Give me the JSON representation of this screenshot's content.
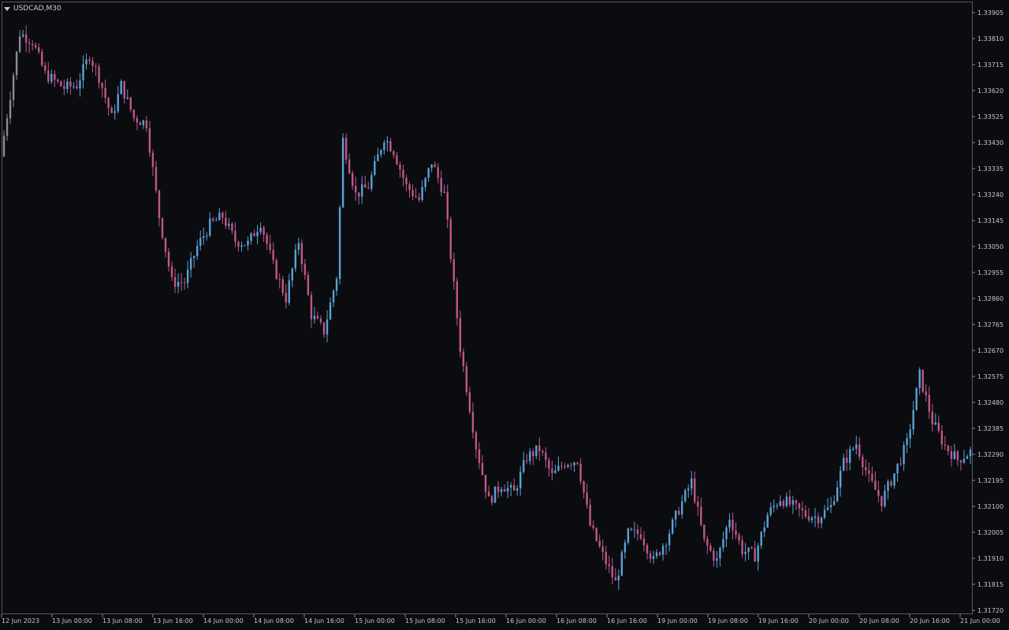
{
  "header": {
    "symbol": "USDCAD,M30"
  },
  "colors": {
    "background": "#0b0c10",
    "bull": "#5aa2d6",
    "bear": "#c0578a",
    "neutral": "#8c8c8c",
    "axis_text": "#c8c8c8",
    "frame": "#5a5a5a"
  },
  "chart_data": {
    "type": "candlestick",
    "title": "USDCAD,M30",
    "grid": false,
    "ylim": [
      1.3172,
      1.3393
    ],
    "yticks": [
      "1.33905",
      "1.33810",
      "1.33715",
      "1.33620",
      "1.33525",
      "1.33430",
      "1.33335",
      "1.33240",
      "1.33145",
      "1.33050",
      "1.32955",
      "1.32860",
      "1.32765",
      "1.32670",
      "1.32575",
      "1.32480",
      "1.32385",
      "1.32290",
      "1.32195",
      "1.32100",
      "1.32005",
      "1.31910",
      "1.31815",
      "1.31720"
    ],
    "xticks": [
      "12 Jun 2023",
      "13 Jun 00:00",
      "13 Jun 08:00",
      "13 Jun 16:00",
      "14 Jun 00:00",
      "14 Jun 08:00",
      "14 Jun 16:00",
      "15 Jun 00:00",
      "15 Jun 08:00",
      "15 Jun 16:00",
      "16 Jun 00:00",
      "16 Jun 08:00",
      "16 Jun 16:00",
      "19 Jun 00:00",
      "19 Jun 08:00",
      "19 Jun 16:00",
      "20 Jun 00:00",
      "20 Jun 08:00",
      "20 Jun 16:00",
      "21 Jun 00:00"
    ],
    "close_path": [
      [
        0,
        1.3338
      ],
      [
        6,
        1.3383
      ],
      [
        10,
        1.338
      ],
      [
        14,
        1.3368
      ],
      [
        20,
        1.3363
      ],
      [
        24,
        1.3364
      ],
      [
        28,
        1.3375
      ],
      [
        31,
        1.3367
      ],
      [
        35,
        1.3352
      ],
      [
        38,
        1.3364
      ],
      [
        42,
        1.3352
      ],
      [
        46,
        1.335
      ],
      [
        50,
        1.3316
      ],
      [
        54,
        1.3292
      ],
      [
        58,
        1.3292
      ],
      [
        62,
        1.3305
      ],
      [
        66,
        1.3313
      ],
      [
        70,
        1.3316
      ],
      [
        74,
        1.3307
      ],
      [
        78,
        1.3306
      ],
      [
        82,
        1.3314
      ],
      [
        86,
        1.3298
      ],
      [
        90,
        1.3286
      ],
      [
        94,
        1.3307
      ],
      [
        98,
        1.328
      ],
      [
        102,
        1.3274
      ],
      [
        106,
        1.3294
      ],
      [
        108,
        1.3344
      ],
      [
        112,
        1.3324
      ],
      [
        116,
        1.3327
      ],
      [
        121,
        1.3345
      ],
      [
        124,
        1.334
      ],
      [
        128,
        1.3327
      ],
      [
        132,
        1.3322
      ],
      [
        136,
        1.3336
      ],
      [
        140,
        1.3324
      ],
      [
        145,
        1.3268
      ],
      [
        150,
        1.3232
      ],
      [
        154,
        1.3212
      ],
      [
        158,
        1.3218
      ],
      [
        162,
        1.3215
      ],
      [
        166,
        1.3228
      ],
      [
        170,
        1.3231
      ],
      [
        174,
        1.3221
      ],
      [
        178,
        1.3226
      ],
      [
        182,
        1.3227
      ],
      [
        186,
        1.3203
      ],
      [
        190,
        1.3192
      ],
      [
        194,
        1.3182
      ],
      [
        198,
        1.32
      ],
      [
        202,
        1.32
      ],
      [
        206,
        1.319
      ],
      [
        210,
        1.3198
      ],
      [
        214,
        1.3209
      ],
      [
        218,
        1.3219
      ],
      [
        222,
        1.3197
      ],
      [
        226,
        1.319
      ],
      [
        230,
        1.3206
      ],
      [
        234,
        1.3194
      ],
      [
        238,
        1.3192
      ],
      [
        242,
        1.3207
      ],
      [
        246,
        1.3213
      ],
      [
        250,
        1.321
      ],
      [
        254,
        1.3207
      ],
      [
        258,
        1.3206
      ],
      [
        262,
        1.321
      ],
      [
        266,
        1.3226
      ],
      [
        270,
        1.3233
      ],
      [
        274,
        1.322
      ],
      [
        278,
        1.3212
      ],
      [
        282,
        1.3222
      ],
      [
        286,
        1.3233
      ],
      [
        290,
        1.3258
      ],
      [
        294,
        1.3241
      ],
      [
        298,
        1.3232
      ],
      [
        302,
        1.3227
      ],
      [
        306,
        1.323
      ]
    ],
    "candle_count": 306
  }
}
